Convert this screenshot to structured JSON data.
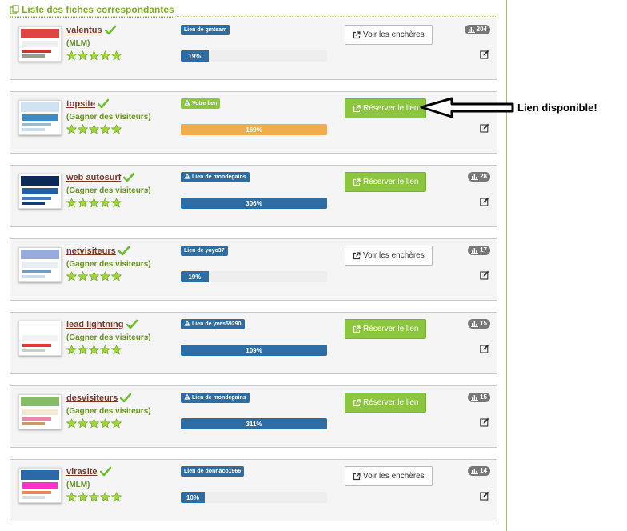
{
  "header": {
    "title": "Liste des fiches correspondantes"
  },
  "annotation": {
    "text": "Lien disponible!"
  },
  "colors": {
    "accent_green": "#8cc63f",
    "badge_blue": "#2e6da4",
    "bar_orange": "#f0ad4e",
    "title_brown": "#7a3b2e",
    "category_green": "#6a8f2a"
  },
  "icons": {
    "header": "list-copy-icon",
    "check": "checkmark-icon",
    "star": "star-icon",
    "warning": "warning-icon",
    "external": "external-link-icon",
    "stats": "bar-chart-icon",
    "edit": "edit-icon"
  },
  "listings": [
    {
      "title": "valentus",
      "category": "(MLM)",
      "badge": "Lien de gmteam",
      "badge_icon": "",
      "badge_color": "blue",
      "progress_label": "19%",
      "progress": 0.19,
      "bar_color": "blue",
      "button": "Voir les enchères",
      "button_style": "default",
      "count": "204",
      "rating": 5
    },
    {
      "title": "topsite",
      "category": "(Gagner des visiteurs)",
      "badge": "Votre lien",
      "badge_icon": "warning",
      "badge_color": "green",
      "progress_label": "169%",
      "progress": 1,
      "bar_color": "orange",
      "button": "Réserver le lien",
      "button_style": "success",
      "count": "",
      "rating": 5
    },
    {
      "title": "web autosurf",
      "category": "(Gagner des visiteurs)",
      "badge": "Lien de mondegains",
      "badge_icon": "warning",
      "badge_color": "blue",
      "progress_label": "306%",
      "progress": 1,
      "bar_color": "blue",
      "button": "Réserver le lien",
      "button_style": "success",
      "count": "28",
      "rating": 5
    },
    {
      "title": "netvisiteurs",
      "category": "(Gagner des visiteurs)",
      "badge": "Lien de yoyo37",
      "badge_icon": "",
      "badge_color": "blue",
      "progress_label": "19%",
      "progress": 0.19,
      "bar_color": "blue",
      "button": "Voir les enchères",
      "button_style": "default",
      "count": "17",
      "rating": 5
    },
    {
      "title": "lead lightning",
      "category": "(Gagner des visiteurs)",
      "badge": "Lien de yves59290",
      "badge_icon": "warning",
      "badge_color": "blue",
      "progress_label": "109%",
      "progress": 1,
      "bar_color": "blue",
      "button": "Réserver le lien",
      "button_style": "success",
      "count": "15",
      "rating": 5
    },
    {
      "title": "desvisiteurs",
      "category": "(Gagner des visiteurs)",
      "badge": "Lien de mondegains",
      "badge_icon": "warning",
      "badge_color": "blue",
      "progress_label": "311%",
      "progress": 1,
      "bar_color": "blue",
      "button": "Réserver le lien",
      "button_style": "success",
      "count": "15",
      "rating": 5
    },
    {
      "title": "virasite",
      "category": "(MLM)",
      "badge": "Lien de donnaco1966",
      "badge_icon": "",
      "badge_color": "blue",
      "progress_label": "10%",
      "progress": 0.1,
      "bar_color": "blue",
      "button": "Voir les enchères",
      "button_style": "default",
      "count": "14",
      "rating": 5
    }
  ]
}
